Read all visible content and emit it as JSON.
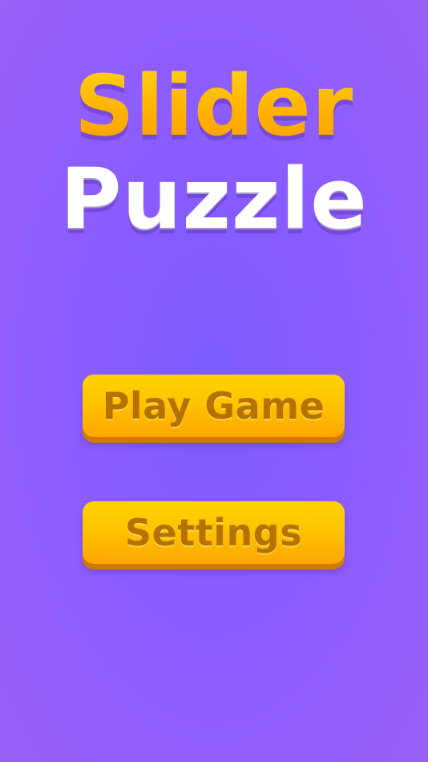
{
  "title": {
    "line1": "Slider",
    "line2": "Puzzle"
  },
  "menu": {
    "play_label": "Play Game",
    "settings_label": "Settings"
  },
  "colors": {
    "background": "#8a5cff",
    "title_line1": "#ffb300",
    "title_line2": "#ffffff",
    "button_fill": "#ffc400",
    "button_text": "#b57200"
  }
}
